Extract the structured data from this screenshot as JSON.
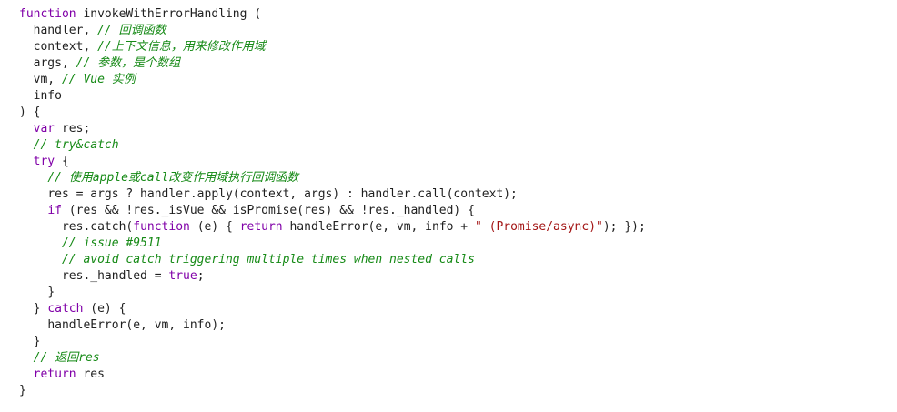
{
  "colors": {
    "keyword": "#8000a8",
    "comment": "#168a16",
    "string": "#a31515",
    "text": "#1f1f1f",
    "background": "#ffffff"
  },
  "code": {
    "lines": [
      {
        "indent": "",
        "tokens": [
          {
            "t": "kw",
            "v": "function"
          },
          {
            "t": "plain",
            "v": " invokeWithErrorHandling ("
          }
        ]
      },
      {
        "indent": "  ",
        "tokens": [
          {
            "t": "plain",
            "v": "handler, "
          },
          {
            "t": "comment",
            "v": "// 回调函数"
          }
        ]
      },
      {
        "indent": "  ",
        "tokens": [
          {
            "t": "plain",
            "v": "context, "
          },
          {
            "t": "comment",
            "v": "//上下文信息，用来修改作用域"
          }
        ]
      },
      {
        "indent": "  ",
        "tokens": [
          {
            "t": "plain",
            "v": "args, "
          },
          {
            "t": "comment",
            "v": "// 参数，是个数组"
          }
        ]
      },
      {
        "indent": "  ",
        "tokens": [
          {
            "t": "plain",
            "v": "vm, "
          },
          {
            "t": "comment",
            "v": "// Vue 实例"
          }
        ]
      },
      {
        "indent": "  ",
        "tokens": [
          {
            "t": "plain",
            "v": "info"
          }
        ]
      },
      {
        "indent": "",
        "tokens": [
          {
            "t": "plain",
            "v": ") {"
          }
        ]
      },
      {
        "indent": "  ",
        "tokens": [
          {
            "t": "kw",
            "v": "var"
          },
          {
            "t": "plain",
            "v": " res;"
          }
        ]
      },
      {
        "indent": "  ",
        "tokens": [
          {
            "t": "comment",
            "v": "// try&catch"
          }
        ]
      },
      {
        "indent": "  ",
        "tokens": [
          {
            "t": "kw",
            "v": "try"
          },
          {
            "t": "plain",
            "v": " {"
          }
        ]
      },
      {
        "indent": "    ",
        "tokens": [
          {
            "t": "comment",
            "v": "// 使用apple或call改变作用域执行回调函数"
          }
        ]
      },
      {
        "indent": "    ",
        "tokens": [
          {
            "t": "plain",
            "v": "res = args ? handler.apply(context, args) : handler.call(context);"
          }
        ]
      },
      {
        "indent": "    ",
        "tokens": [
          {
            "t": "kw",
            "v": "if"
          },
          {
            "t": "plain",
            "v": " (res && !res._isVue && isPromise(res) && !res._handled) {"
          }
        ]
      },
      {
        "indent": "      ",
        "tokens": [
          {
            "t": "plain",
            "v": "res.catch("
          },
          {
            "t": "kw",
            "v": "function"
          },
          {
            "t": "plain",
            "v": " (e) { "
          },
          {
            "t": "kw",
            "v": "return"
          },
          {
            "t": "plain",
            "v": " handleError(e, vm, info + "
          },
          {
            "t": "str",
            "v": "\" (Promise/async)\""
          },
          {
            "t": "plain",
            "v": "); });"
          }
        ]
      },
      {
        "indent": "      ",
        "tokens": [
          {
            "t": "comment",
            "v": "// issue #9511"
          }
        ]
      },
      {
        "indent": "      ",
        "tokens": [
          {
            "t": "comment",
            "v": "// avoid catch triggering multiple times when nested calls"
          }
        ]
      },
      {
        "indent": "      ",
        "tokens": [
          {
            "t": "plain",
            "v": "res._handled = "
          },
          {
            "t": "kw",
            "v": "true"
          },
          {
            "t": "plain",
            "v": ";"
          }
        ]
      },
      {
        "indent": "    ",
        "tokens": [
          {
            "t": "plain",
            "v": "}"
          }
        ]
      },
      {
        "indent": "  ",
        "tokens": [
          {
            "t": "plain",
            "v": "} "
          },
          {
            "t": "kw",
            "v": "catch"
          },
          {
            "t": "plain",
            "v": " (e) {"
          }
        ]
      },
      {
        "indent": "    ",
        "tokens": [
          {
            "t": "plain",
            "v": "handleError(e, vm, info);"
          }
        ]
      },
      {
        "indent": "  ",
        "tokens": [
          {
            "t": "plain",
            "v": "}"
          }
        ]
      },
      {
        "indent": "  ",
        "tokens": [
          {
            "t": "comment",
            "v": "// 返回res"
          }
        ]
      },
      {
        "indent": "  ",
        "tokens": [
          {
            "t": "kw",
            "v": "return"
          },
          {
            "t": "plain",
            "v": " res"
          }
        ]
      },
      {
        "indent": "",
        "tokens": [
          {
            "t": "plain",
            "v": "}"
          }
        ]
      }
    ]
  }
}
